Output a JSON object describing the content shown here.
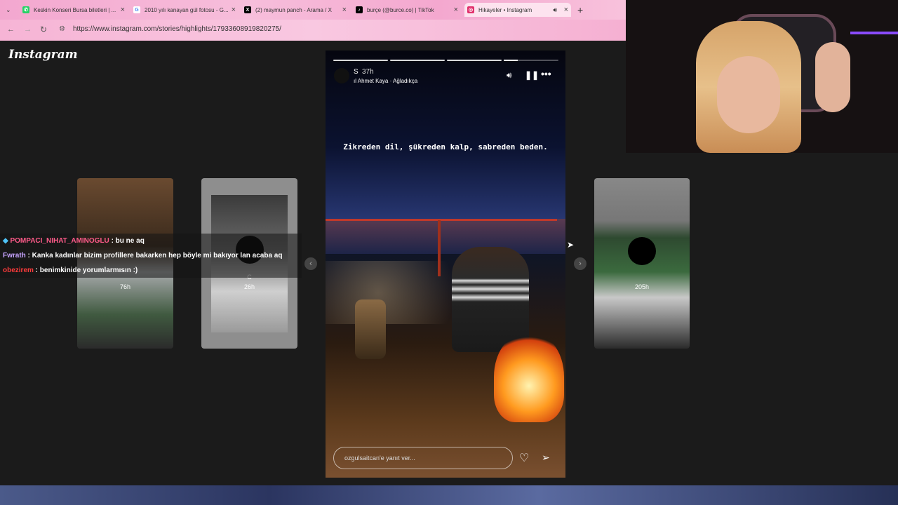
{
  "browser": {
    "tabs": [
      {
        "label": "Keskin Konseri Bursa biletleri | ...",
        "icon": "whatsapp-icon",
        "color": "#25d366"
      },
      {
        "label": "2010 yılı kanayan gül fotosu - G...",
        "icon": "google-icon",
        "color": "#4285f4"
      },
      {
        "label": "(2) maymun panch - Arama / X",
        "icon": "x-icon",
        "color": "#000000"
      },
      {
        "label": "burçe (@burce.co) | TikTok",
        "icon": "tiktok-icon",
        "color": "#000000"
      },
      {
        "label": "Hikayeler • Instagram",
        "icon": "instagram-icon",
        "color": "#e1306c"
      }
    ],
    "url": "https://www.instagram.com/stories/highlights/17933608919820275/"
  },
  "instagram": {
    "logo": "Instagram",
    "story": {
      "user": "S",
      "time": "37h",
      "music": "Ahmet Kaya · Ağladıkça",
      "caption": "Zikreden dil, şükreden kalp, sabreden beden.",
      "reply_placeholder": "ozgulsaitcan'e yanıt ver...",
      "progress": [
        1,
        1,
        1,
        0.25
      ]
    },
    "side_stories": [
      {
        "label": "76h"
      },
      {
        "label": "C",
        "sublabel": "26h"
      },
      {
        "label": "205h"
      }
    ]
  },
  "chat": [
    {
      "user": "POMPACI_NIHAT_AMINOGLU",
      "text": " : bu ne aq"
    },
    {
      "user": "Fwrath",
      "text": " : Kanka kadınlar bizim profillere bakarken hep böyle mi bakıyor lan acaba aq"
    },
    {
      "user": "obezirem",
      "text": " : benimkinide yorumlarmısın :)"
    }
  ]
}
